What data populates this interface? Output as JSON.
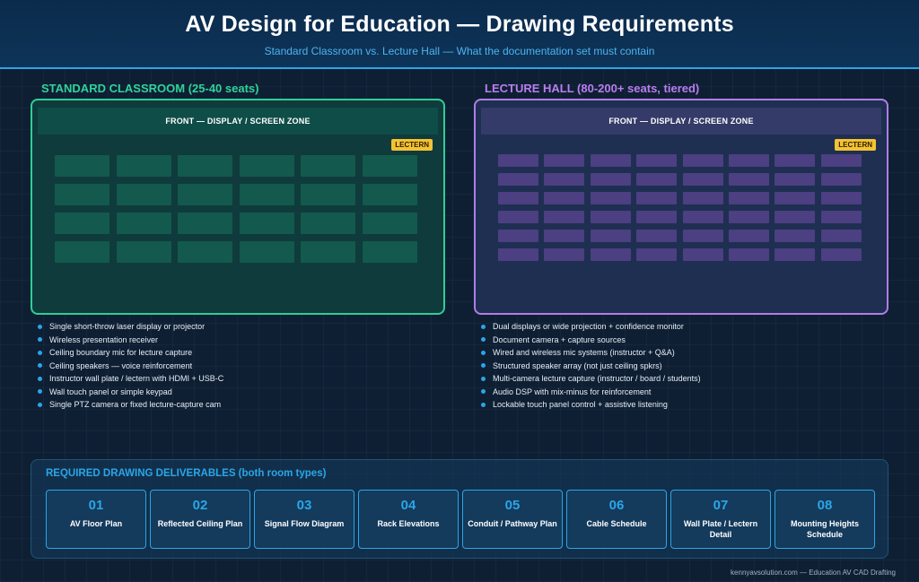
{
  "header": {
    "title": "AV Design for Education — Drawing Requirements",
    "subtitle": "Standard Classroom vs. Lecture Hall — What the documentation set must contain"
  },
  "classroom": {
    "title": "STANDARD CLASSROOM (25-40 seats)",
    "front_label": "FRONT — DISPLAY / SCREEN ZONE",
    "lectern_label": "LECTERN",
    "seat_rows": 4,
    "seat_cols": 6,
    "features": [
      "Single short-throw laser display or projector",
      "Wireless presentation receiver",
      "Ceiling boundary mic for lecture capture",
      "Ceiling speakers — voice reinforcement",
      "Instructor wall plate / lectern with HDMI + USB-C",
      "Wall touch panel or simple keypad",
      "Single PTZ camera or fixed lecture-capture cam"
    ]
  },
  "lecture_hall": {
    "title": "LECTURE HALL (80-200+ seats, tiered)",
    "front_label": "FRONT — DISPLAY / SCREEN ZONE",
    "lectern_label": "LECTERN",
    "seat_rows": 6,
    "seat_cols": 8,
    "features": [
      "Dual displays or wide projection + confidence monitor",
      "Document camera + capture sources",
      "Wired and wireless mic systems (instructor + Q&A)",
      "Structured speaker array (not just ceiling spkrs)",
      "Multi-camera lecture capture (instructor / board / students)",
      "Audio DSP with mix-minus for reinforcement",
      "Lockable touch panel control + assistive listening"
    ]
  },
  "deliverables": {
    "title": "REQUIRED DRAWING DELIVERABLES (both room types)",
    "items": [
      {
        "num": "01",
        "label": "AV Floor Plan"
      },
      {
        "num": "02",
        "label": "Reflected Ceiling Plan"
      },
      {
        "num": "03",
        "label": "Signal Flow Diagram"
      },
      {
        "num": "04",
        "label": "Rack Elevations"
      },
      {
        "num": "05",
        "label": "Conduit / Pathway Plan"
      },
      {
        "num": "06",
        "label": "Cable Schedule"
      },
      {
        "num": "07",
        "label": "Wall Plate / Lectern Detail"
      },
      {
        "num": "08",
        "label": "Mounting Heights Schedule"
      }
    ]
  },
  "footer": "kennyavsolution.com — Education AV CAD Drafting",
  "colors": {
    "classroom_accent": "#2fcf95",
    "lecture_hall_accent": "#b07ee8",
    "deliverable_accent": "#2aa6e8",
    "lectern": "#f4c233"
  }
}
